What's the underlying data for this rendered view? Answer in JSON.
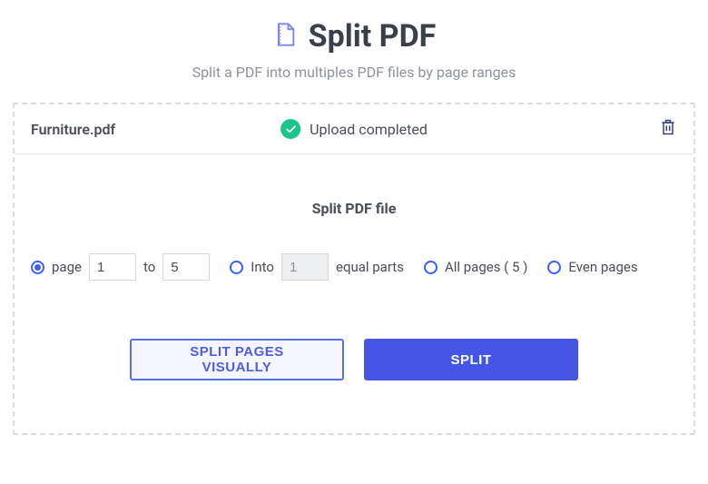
{
  "header": {
    "title": "Split PDF",
    "subtitle": "Split a PDF into multiples PDF files by page ranges"
  },
  "file": {
    "name": "Furniture.pdf",
    "status": "Upload completed"
  },
  "section": {
    "title": "Split PDF file"
  },
  "options": {
    "page_label": "page",
    "page_from": "1",
    "to_label": "to",
    "page_to": "5",
    "into_label": "Into",
    "into_value": "1",
    "equal_parts_label": "equal parts",
    "all_pages_label": "All pages ( 5 )",
    "even_pages_label": "Even pages"
  },
  "buttons": {
    "visual": "SPLIT PAGES VISUALLY",
    "split": "SPLIT"
  }
}
